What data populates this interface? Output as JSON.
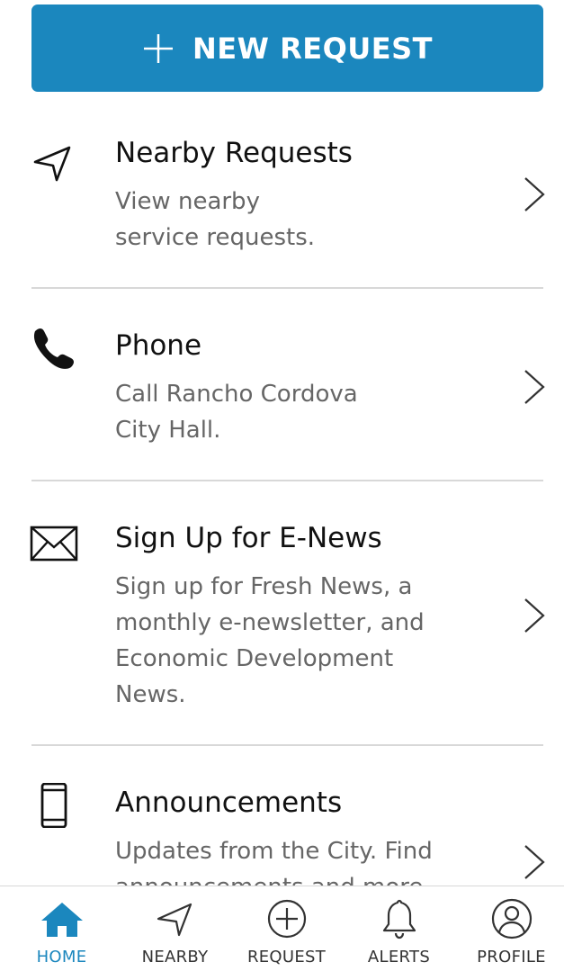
{
  "new_request": {
    "label": "NEW REQUEST"
  },
  "items": [
    {
      "title": "Nearby Requests",
      "desc": "View nearby service requests.",
      "icon": "navigation-arrow-icon"
    },
    {
      "title": "Phone",
      "desc": "Call Rancho Cordova City Hall.",
      "icon": "phone-icon"
    },
    {
      "title": "Sign Up for E-News",
      "desc": "Sign up for Fresh News, a monthly e-newsletter, and Economic Development News.",
      "icon": "envelope-icon"
    },
    {
      "title": "Announcements",
      "desc": "Updates from the City. Find announcements and more.",
      "icon": "smartphone-icon"
    }
  ],
  "tabs": [
    {
      "label": "HOME",
      "icon": "home-icon",
      "active": true
    },
    {
      "label": "NEARBY",
      "icon": "navigation-arrow-icon",
      "active": false
    },
    {
      "label": "REQUEST",
      "icon": "plus-circle-icon",
      "active": false
    },
    {
      "label": "ALERTS",
      "icon": "bell-icon",
      "active": false
    },
    {
      "label": "PROFILE",
      "icon": "user-circle-icon",
      "active": false
    }
  ],
  "colors": {
    "accent": "#1b87be",
    "divider": "#d8d8d8",
    "desc_text": "#666666"
  }
}
